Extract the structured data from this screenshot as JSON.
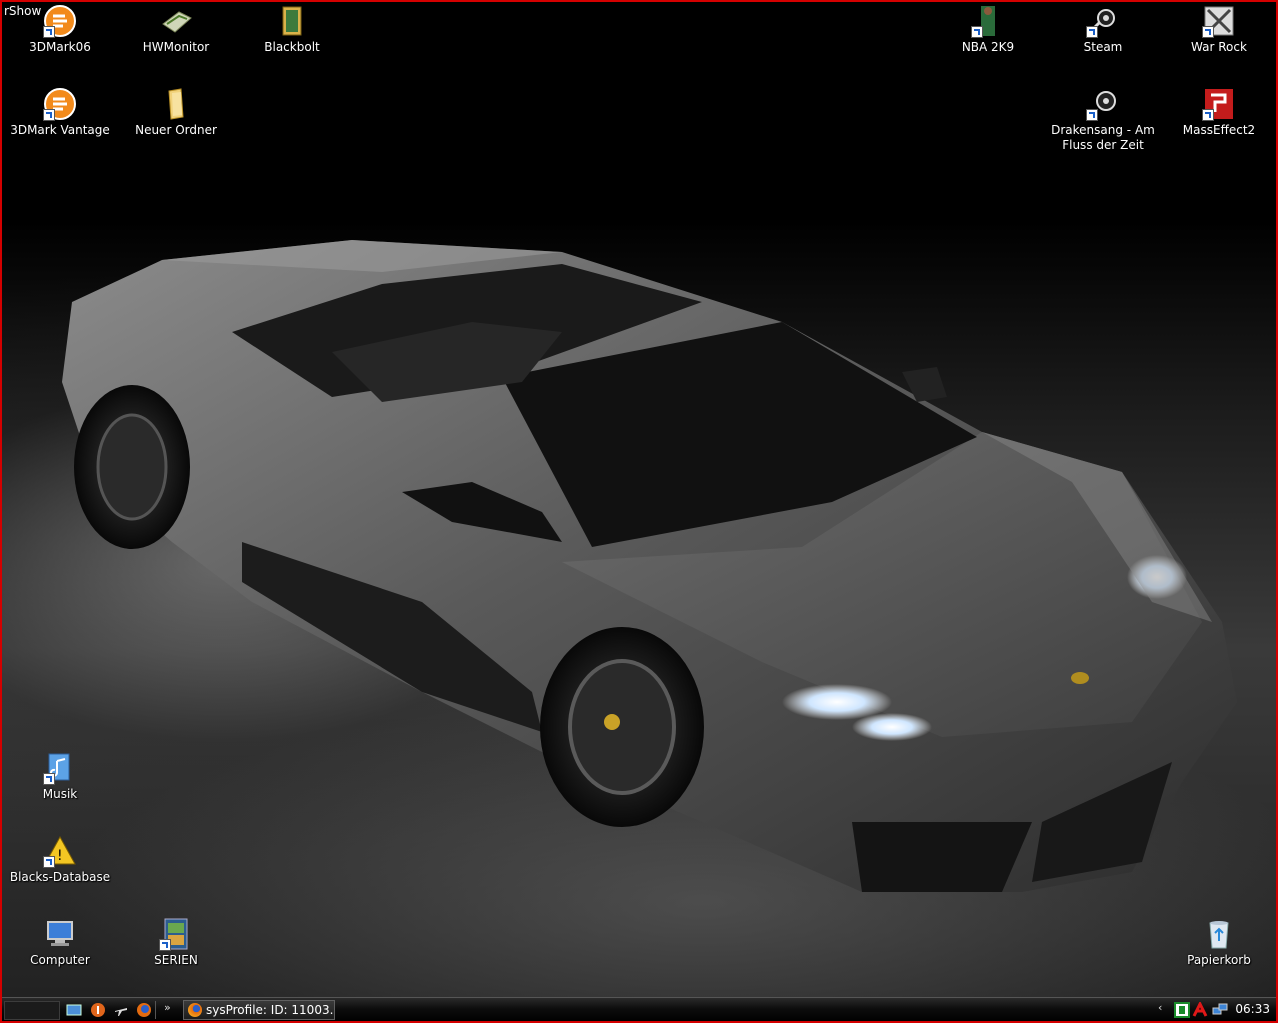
{
  "desktop": {
    "partial_label": "rShow",
    "icons": [
      {
        "label": "3DMark06"
      },
      {
        "label": "HWMonitor"
      },
      {
        "label": "Blackbolt"
      },
      {
        "label": "NBA 2K9"
      },
      {
        "label": "Steam"
      },
      {
        "label": "War Rock"
      },
      {
        "label": "3DMark Vantage"
      },
      {
        "label": "Neuer Ordner"
      },
      {
        "label": "Drakensang - Am Fluss der Zeit"
      },
      {
        "label": "MassEffect2"
      },
      {
        "label": "Musik"
      },
      {
        "label": "Blacks-Database"
      },
      {
        "label": "Computer"
      },
      {
        "label": "SERIEN"
      },
      {
        "label": "Papierkorb"
      }
    ]
  },
  "taskbar": {
    "quicklaunch_icons": [
      "show-desktop-icon",
      "avira-icon",
      "airplane-icon",
      "firefox-icon"
    ],
    "overflow_chevron": "»",
    "active_window": {
      "label": "sysProfile: ID: 11003...",
      "icon": "firefox-icon"
    },
    "tray": {
      "expand_chevron": "‹",
      "icons": [
        "green-tray-icon",
        "red-tray-icon",
        "network-icon"
      ],
      "clock": "06:33"
    }
  }
}
